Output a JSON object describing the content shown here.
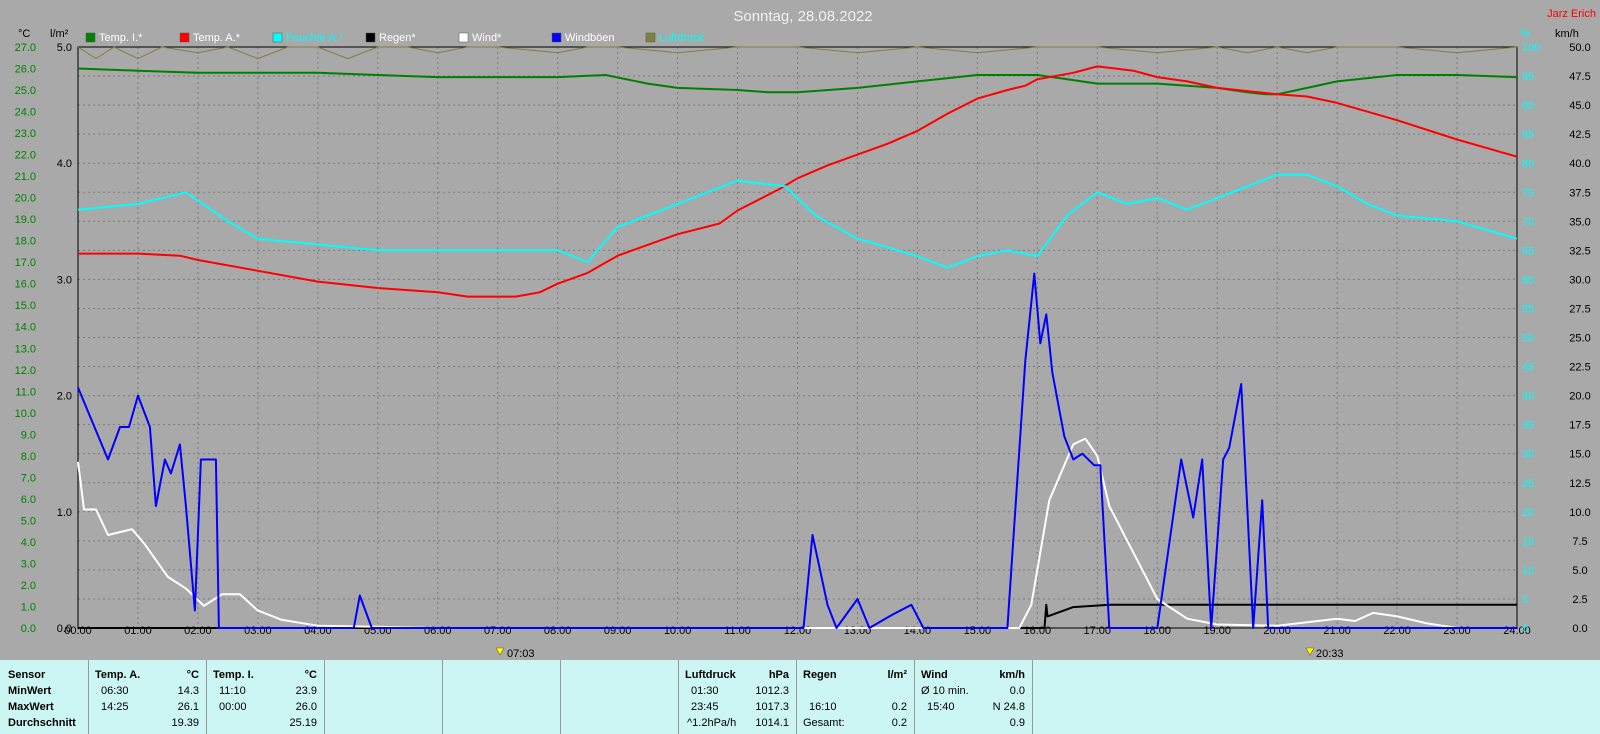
{
  "header": {
    "title": "Sonntag, 28.08.2022",
    "author": "Jarz Erich"
  },
  "legend": [
    {
      "label": "Temp. I.*",
      "color": "#008000",
      "text_color": "#ffffff"
    },
    {
      "label": "Temp. A.*",
      "color": "#ff0000",
      "text_color": "#ffffff"
    },
    {
      "label": "Feuchte A.*",
      "color": "#00ffff",
      "text_color": "#00ffff"
    },
    {
      "label": "Regen*",
      "color": "#000000",
      "text_color": "#ffffff"
    },
    {
      "label": "Wind*",
      "color": "#ffffff",
      "text_color": "#ffffff"
    },
    {
      "label": "Windböen",
      "color": "#0000ff",
      "text_color": "#ffffff"
    },
    {
      "label": "Luftdruck",
      "color": "#808040",
      "text_color": "#00ffff"
    }
  ],
  "axis_units": {
    "temp": "°C",
    "rain": "l/m²",
    "humidity": "%",
    "wind": "km/h"
  },
  "sun": {
    "sunrise": "07:03",
    "sunset": "20:33"
  },
  "chart_data": {
    "type": "line",
    "x_unit": "hours",
    "x_ticks": [
      "00:00",
      "01:00",
      "02:00",
      "03:00",
      "04:00",
      "05:00",
      "06:00",
      "07:00",
      "08:00",
      "09:00",
      "10:00",
      "11:00",
      "12:00",
      "13:00",
      "14:00",
      "15:00",
      "16:00",
      "17:00",
      "18:00",
      "19:00",
      "20:00",
      "21:00",
      "22:00",
      "23:00",
      "24:00"
    ],
    "axes": {
      "temp": {
        "min": 0,
        "max": 27,
        "step": 1,
        "color": "#008000"
      },
      "rain": {
        "min": 0,
        "max": 5,
        "step": 1,
        "color": "#000000"
      },
      "humidity": {
        "min": 0,
        "max": 100,
        "step": 5,
        "color": "#00ffff"
      },
      "wind": {
        "min": 0,
        "max": 50,
        "step": 2.5,
        "color": "#000000"
      }
    },
    "grid": true,
    "series": [
      {
        "name": "Temp. I.*",
        "axis": "temp",
        "color": "#008000",
        "points": [
          [
            0,
            26.0
          ],
          [
            1,
            25.9
          ],
          [
            2,
            25.8
          ],
          [
            3,
            25.8
          ],
          [
            4,
            25.8
          ],
          [
            5,
            25.7
          ],
          [
            6,
            25.6
          ],
          [
            7,
            25.6
          ],
          [
            8,
            25.6
          ],
          [
            8.8,
            25.7
          ],
          [
            9.5,
            25.3
          ],
          [
            10,
            25.1
          ],
          [
            11,
            25.0
          ],
          [
            11.5,
            24.9
          ],
          [
            12,
            24.9
          ],
          [
            13,
            25.1
          ],
          [
            14,
            25.4
          ],
          [
            15,
            25.7
          ],
          [
            16,
            25.7
          ],
          [
            16.5,
            25.5
          ],
          [
            17,
            25.3
          ],
          [
            18,
            25.3
          ],
          [
            18.5,
            25.2
          ],
          [
            19,
            25.1
          ],
          [
            19.5,
            24.9
          ],
          [
            19.8,
            24.8
          ],
          [
            20,
            24.8
          ],
          [
            20.5,
            25.1
          ],
          [
            21,
            25.4
          ],
          [
            22,
            25.7
          ],
          [
            23,
            25.7
          ],
          [
            24,
            25.6
          ]
        ]
      },
      {
        "name": "Temp. A.*",
        "axis": "temp",
        "color": "#ff0000",
        "points": [
          [
            0,
            17.4
          ],
          [
            1,
            17.4
          ],
          [
            1.7,
            17.3
          ],
          [
            2,
            17.1
          ],
          [
            3,
            16.6
          ],
          [
            4,
            16.1
          ],
          [
            5,
            15.8
          ],
          [
            6,
            15.6
          ],
          [
            6.5,
            15.4
          ],
          [
            7.3,
            15.4
          ],
          [
            7.7,
            15.6
          ],
          [
            8,
            16.0
          ],
          [
            8.5,
            16.5
          ],
          [
            9,
            17.3
          ],
          [
            10,
            18.3
          ],
          [
            10.7,
            18.8
          ],
          [
            11,
            19.4
          ],
          [
            11.7,
            20.4
          ],
          [
            12,
            20.9
          ],
          [
            12.5,
            21.5
          ],
          [
            13,
            22.0
          ],
          [
            13.5,
            22.5
          ],
          [
            14,
            23.1
          ],
          [
            14.5,
            23.9
          ],
          [
            15,
            24.6
          ],
          [
            15.5,
            25.0
          ],
          [
            15.8,
            25.2
          ],
          [
            16,
            25.5
          ],
          [
            16.2,
            25.6
          ],
          [
            16.6,
            25.8
          ],
          [
            17,
            26.1
          ],
          [
            17.3,
            26.0
          ],
          [
            17.6,
            25.9
          ],
          [
            18,
            25.6
          ],
          [
            18.5,
            25.4
          ],
          [
            19,
            25.1
          ],
          [
            20,
            24.8
          ],
          [
            20.5,
            24.7
          ],
          [
            21,
            24.4
          ],
          [
            22,
            23.6
          ],
          [
            23,
            22.7
          ],
          [
            24,
            21.9
          ]
        ]
      },
      {
        "name": "Feuchte A.*",
        "axis": "humidity",
        "color": "#00ffff",
        "points": [
          [
            0,
            72
          ],
          [
            1,
            73
          ],
          [
            1.8,
            75
          ],
          [
            2.5,
            70
          ],
          [
            3,
            67
          ],
          [
            4,
            66
          ],
          [
            5,
            65
          ],
          [
            6,
            65
          ],
          [
            7,
            65
          ],
          [
            8,
            65
          ],
          [
            8.5,
            63
          ],
          [
            9,
            69
          ],
          [
            10,
            73
          ],
          [
            11,
            77
          ],
          [
            11.8,
            76
          ],
          [
            12.3,
            71
          ],
          [
            13,
            67
          ],
          [
            14,
            64
          ],
          [
            14.5,
            62
          ],
          [
            15,
            64
          ],
          [
            15.5,
            65
          ],
          [
            16,
            64
          ],
          [
            16.5,
            71
          ],
          [
            17,
            75
          ],
          [
            17.5,
            73
          ],
          [
            18,
            74
          ],
          [
            18.5,
            72
          ],
          [
            19,
            74
          ],
          [
            19.5,
            76
          ],
          [
            20,
            78
          ],
          [
            20.5,
            78
          ],
          [
            21,
            76
          ],
          [
            21.5,
            73
          ],
          [
            22,
            71
          ],
          [
            23,
            70
          ],
          [
            24,
            67
          ]
        ]
      },
      {
        "name": "Regen*",
        "axis": "rain",
        "color": "#000000",
        "points": [
          [
            0,
            0
          ],
          [
            16.12,
            0
          ],
          [
            16.15,
            0.2
          ],
          [
            16.17,
            0.1
          ],
          [
            16.6,
            0.18
          ],
          [
            17.2,
            0.2
          ],
          [
            24,
            0.2
          ]
        ]
      },
      {
        "name": "Wind*",
        "axis": "wind",
        "color": "#ffffff",
        "points": [
          [
            0,
            14.3
          ],
          [
            0.1,
            10.2
          ],
          [
            0.3,
            10.2
          ],
          [
            0.5,
            8.0
          ],
          [
            0.9,
            8.5
          ],
          [
            1.1,
            7.3
          ],
          [
            1.5,
            4.4
          ],
          [
            1.8,
            3.4
          ],
          [
            2.1,
            1.9
          ],
          [
            2.4,
            2.9
          ],
          [
            2.7,
            2.9
          ],
          [
            3.0,
            1.5
          ],
          [
            3.4,
            0.7
          ],
          [
            4,
            0.2
          ],
          [
            5,
            0.1
          ],
          [
            6,
            0
          ],
          [
            15.7,
            0
          ],
          [
            15.9,
            2
          ],
          [
            16.2,
            11
          ],
          [
            16.6,
            15.8
          ],
          [
            16.8,
            16.3
          ],
          [
            17,
            14.8
          ],
          [
            17.2,
            10.5
          ],
          [
            17.5,
            7.5
          ],
          [
            17.8,
            4.5
          ],
          [
            18,
            2.5
          ],
          [
            18.5,
            0.8
          ],
          [
            19,
            0.3
          ],
          [
            20,
            0.2
          ],
          [
            21,
            0.8
          ],
          [
            21.3,
            0.6
          ],
          [
            21.6,
            1.3
          ],
          [
            22,
            1.0
          ],
          [
            22.5,
            0.4
          ],
          [
            23,
            0
          ],
          [
            24,
            0
          ]
        ]
      },
      {
        "name": "Windböen",
        "axis": "wind",
        "color": "#0000ff",
        "points": [
          [
            0,
            20.7
          ],
          [
            0.5,
            14.5
          ],
          [
            0.7,
            17.3
          ],
          [
            0.85,
            17.3
          ],
          [
            1.0,
            20.0
          ],
          [
            1.2,
            17.3
          ],
          [
            1.3,
            10.5
          ],
          [
            1.45,
            14.5
          ],
          [
            1.55,
            13.3
          ],
          [
            1.7,
            15.8
          ],
          [
            1.8,
            10.5
          ],
          [
            1.95,
            1.5
          ],
          [
            2.05,
            14.5
          ],
          [
            2.3,
            14.5
          ],
          [
            2.35,
            0
          ],
          [
            4.6,
            0
          ],
          [
            4.7,
            2.8
          ],
          [
            4.9,
            0
          ],
          [
            12.1,
            0
          ],
          [
            12.25,
            8.0
          ],
          [
            12.5,
            2.0
          ],
          [
            12.65,
            0
          ],
          [
            13.0,
            2.5
          ],
          [
            13.2,
            0
          ],
          [
            13.6,
            1.2
          ],
          [
            13.9,
            2.0
          ],
          [
            14.1,
            0
          ],
          [
            15.5,
            0
          ],
          [
            15.8,
            23.0
          ],
          [
            15.95,
            30.5
          ],
          [
            16.05,
            24.5
          ],
          [
            16.15,
            27.0
          ],
          [
            16.25,
            22.0
          ],
          [
            16.45,
            16.5
          ],
          [
            16.6,
            14.5
          ],
          [
            16.75,
            15.0
          ],
          [
            16.95,
            14.0
          ],
          [
            17.05,
            14.0
          ],
          [
            17.2,
            0
          ],
          [
            18.0,
            0
          ],
          [
            18.4,
            14.5
          ],
          [
            18.6,
            9.5
          ],
          [
            18.75,
            14.5
          ],
          [
            18.9,
            0
          ],
          [
            19.1,
            14.5
          ],
          [
            19.2,
            15.5
          ],
          [
            19.4,
            21.0
          ],
          [
            19.6,
            0
          ],
          [
            19.75,
            11.0
          ],
          [
            19.85,
            0
          ],
          [
            24,
            0
          ]
        ]
      },
      {
        "name": "Luftdruck",
        "axis": "humidity",
        "color": "#808040",
        "points": [
          [
            0,
            100
          ],
          [
            0.3,
            98
          ],
          [
            0.6,
            100
          ],
          [
            1,
            98
          ],
          [
            1.4,
            100
          ],
          [
            2,
            99
          ],
          [
            2.5,
            100
          ],
          [
            3,
            98
          ],
          [
            3.5,
            100
          ],
          [
            4,
            100
          ],
          [
            4.5,
            98
          ],
          [
            5,
            100
          ],
          [
            5.5,
            100
          ],
          [
            6,
            99
          ],
          [
            6.5,
            100
          ],
          [
            7,
            100
          ],
          [
            8,
            99
          ],
          [
            8.5,
            100
          ],
          [
            9,
            100
          ],
          [
            10,
            99
          ],
          [
            11,
            100
          ],
          [
            12,
            100
          ],
          [
            13,
            99
          ],
          [
            14,
            100
          ],
          [
            15,
            99
          ],
          [
            16,
            100
          ],
          [
            17,
            100
          ],
          [
            18,
            99
          ],
          [
            19,
            100
          ],
          [
            19.5,
            99
          ],
          [
            20,
            100
          ],
          [
            20.5,
            99
          ],
          [
            21,
            100
          ],
          [
            22,
            100
          ],
          [
            23,
            99
          ],
          [
            24,
            100
          ]
        ]
      }
    ]
  },
  "stats": {
    "temp_a": {
      "header_label": "Temp. A.",
      "unit": "°C",
      "min_time": "06:30",
      "min_val": "14.3",
      "max_time": "14:25",
      "max_val": "26.1",
      "avg_val": "19.39"
    },
    "temp_i": {
      "header_label": "Temp. I.",
      "unit": "°C",
      "min_time": "11:10",
      "min_val": "23.9",
      "max_time": "00:00",
      "max_val": "26.0",
      "avg_val": "25.19"
    },
    "row_labels": {
      "sensor": "Sensor",
      "min": "MinWert",
      "max": "MaxWert",
      "avg": "Durchschnitt"
    },
    "pressure": {
      "label": "Luftdruck",
      "unit": "hPa",
      "r1_time": "01:30",
      "r1_val": "1012.3",
      "r2_time": "23:45",
      "r2_val": "1017.3",
      "r3_label": "^1.2hPa/h",
      "r3_val": "1014.1"
    },
    "rain": {
      "label": "Regen",
      "unit": "l/m²",
      "r2_time": "16:10",
      "r2_val": "0.2",
      "r3_label": "Gesamt:",
      "r3_val": "0.2"
    },
    "wind": {
      "label": "Wind",
      "unit": "km/h",
      "r1_label": "Ø 10 min.",
      "r1_val": "0.0",
      "r2_time": "15:40",
      "r2_val": "N 24.8",
      "r3_val": "0.9"
    }
  }
}
